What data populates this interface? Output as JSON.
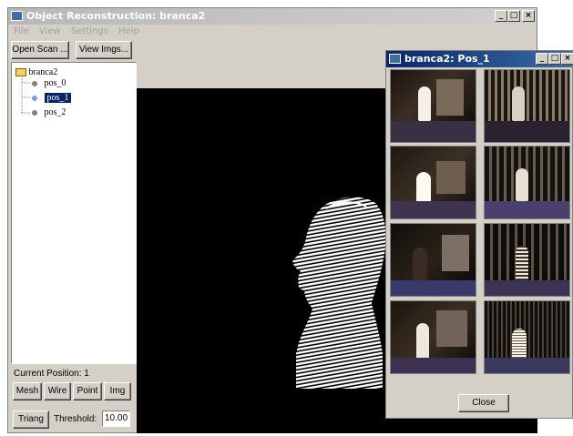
{
  "main_window": {
    "title": "Object Reconstruction: branca2",
    "controls": {
      "minimize": "_",
      "maximize": "□",
      "close": "×"
    }
  },
  "menu": [
    "File",
    "View",
    "Settings",
    "Help"
  ],
  "toolbar": {
    "open_scan": "Open Scan ...",
    "view_imgs": "View Imgs..."
  },
  "tree": {
    "root": "branca2",
    "items": [
      {
        "label": "pos_0",
        "selected": false
      },
      {
        "label": "pos_1",
        "selected": true
      },
      {
        "label": "pos_2",
        "selected": false
      }
    ]
  },
  "status": {
    "current_position": "Current Position: 1"
  },
  "render_buttons": [
    "Mesh",
    "Wire",
    "Point",
    "Img"
  ],
  "bottom": {
    "triang": "Triang",
    "threshold_label": "Threshold:",
    "threshold_value": "10.00"
  },
  "image_window": {
    "title": "branca2: Pos_1",
    "close_button": "Close",
    "thumbnails": 8
  },
  "colors": {
    "selection": "#0a246a",
    "face_bg": "#d4d0c8",
    "viewport_bg": "#000000"
  }
}
